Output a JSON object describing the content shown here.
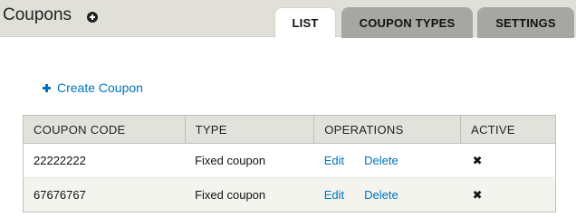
{
  "header": {
    "title": "Coupons",
    "shortcut_icon": "plus-circle-icon"
  },
  "tabs": [
    {
      "label": "LIST",
      "active": true
    },
    {
      "label": "COUPON TYPES",
      "active": false
    },
    {
      "label": "SETTINGS",
      "active": false
    }
  ],
  "actions": {
    "create_label": "Create Coupon",
    "create_icon": "plus-icon"
  },
  "table": {
    "columns": [
      "COUPON CODE",
      "TYPE",
      "OPERATIONS",
      "ACTIVE"
    ],
    "rows": [
      {
        "code": "22222222",
        "type": "Fixed coupon",
        "edit": "Edit",
        "delete": "Delete",
        "active_icon": "x-icon",
        "active_glyph": "✖"
      },
      {
        "code": "67676767",
        "type": "Fixed coupon",
        "edit": "Edit",
        "delete": "Delete",
        "active_icon": "x-icon",
        "active_glyph": "✖"
      }
    ]
  },
  "colors": {
    "link": "#0074bd",
    "header_bg": "#e0e0d8",
    "inactive_tab": "#a6a7a2"
  }
}
